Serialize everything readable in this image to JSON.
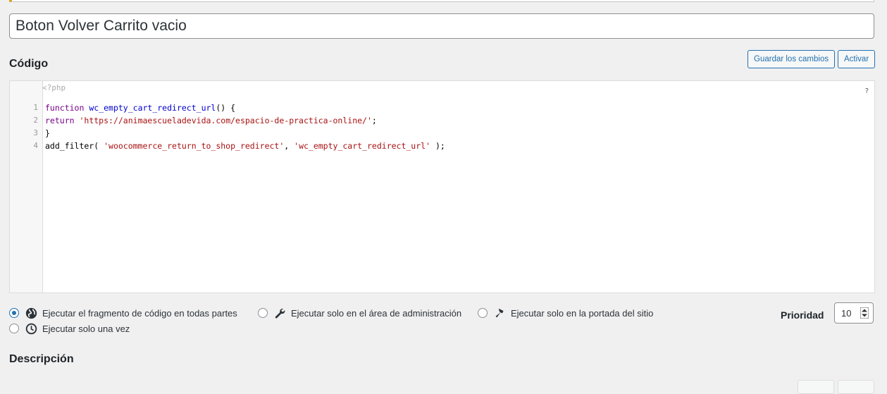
{
  "snippet": {
    "title": "Boton Volver Carrito vacio"
  },
  "code_section": {
    "heading": "Código",
    "save_button": "Guardar los cambios",
    "activate_button": "Activar"
  },
  "editor": {
    "php_open_tag": "<?php",
    "help_mark": "?",
    "line_numbers": [
      "1",
      "2",
      "3",
      "4"
    ],
    "lines": [
      [
        {
          "cls": "kw",
          "text": "function"
        },
        {
          "cls": "plain",
          "text": " "
        },
        {
          "cls": "fn",
          "text": "wc_empty_cart_redirect_url"
        },
        {
          "cls": "plain",
          "text": "() {"
        }
      ],
      [
        {
          "cls": "kw",
          "text": "return"
        },
        {
          "cls": "plain",
          "text": " "
        },
        {
          "cls": "str",
          "text": "'https://animaescueladevida.com/espacio-de-practica-online/'"
        },
        {
          "cls": "plain",
          "text": ";"
        }
      ],
      [
        {
          "cls": "plain",
          "text": "}"
        }
      ],
      [
        {
          "cls": "plain",
          "text": "add_filter( "
        },
        {
          "cls": "str",
          "text": "'woocommerce_return_to_shop_redirect'"
        },
        {
          "cls": "plain",
          "text": ", "
        },
        {
          "cls": "str",
          "text": "'wc_empty_cart_redirect_url'"
        },
        {
          "cls": "plain",
          "text": " );"
        }
      ]
    ]
  },
  "scope": {
    "options": [
      {
        "label": "Ejecutar el fragmento de código en todas partes",
        "icon": "globe-icon",
        "selected": true
      },
      {
        "label": "Ejecutar solo en el área de administración",
        "icon": "wrench-icon",
        "selected": false
      },
      {
        "label": "Ejecutar solo en la portada del sitio",
        "icon": "hammer-icon",
        "selected": false
      },
      {
        "label": "Ejecutar solo una vez",
        "icon": "clock-icon",
        "selected": false
      }
    ]
  },
  "priority": {
    "label": "Prioridad",
    "value": "10"
  },
  "description": {
    "heading": "Descripción"
  },
  "colors": {
    "accent": "#2271b1",
    "notice": "#dba617",
    "background": "#f0f0f1"
  }
}
